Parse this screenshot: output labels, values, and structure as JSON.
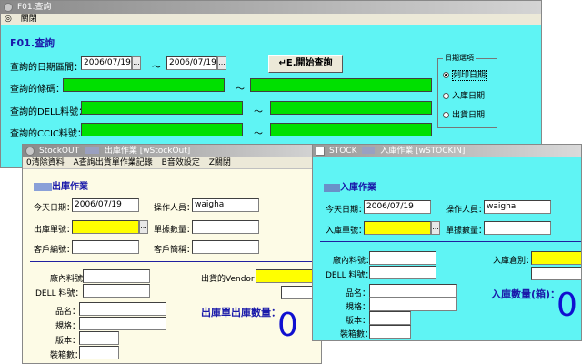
{
  "win1": {
    "title": "F01.查詢",
    "menu_close": "關閉",
    "heading": "F01.查詢",
    "date_range_label": "查詢的日期區間：",
    "date_from": "2006/07/19",
    "tilde": "～",
    "date_to": "2006/07/19",
    "start_button": "E.開始查詢",
    "barcode_label": "查詢的條碼：",
    "dell_label": "查詢的DELL料號：",
    "ccic_label": "查詢的CCIC料號：",
    "dash": "～",
    "date_group_title": "日期選項",
    "radio_print": "列印日期",
    "radio_in": "入庫日期",
    "radio_out": "出貨日期",
    "colors": {
      "window_bg": "#5ff4f4",
      "green_field": "#00e000"
    }
  },
  "win2": {
    "title_prefix": "StockOUT",
    "title_main": "出庫作業 [wStockOut]",
    "menu": [
      "0清除資料",
      "A查詢出貨單作業記錄",
      "B音效設定",
      "Z關閉"
    ],
    "heading": "出庫作業",
    "today_label": "今天日期：",
    "today_value": "2006/07/19",
    "operator_label": "操作人員：",
    "operator_value": "waigha",
    "order_label": "出庫單號：",
    "order_lines_label": "單據數量：",
    "customer_no_label": "客戶編號：",
    "customer_name_label": "客戶簡稱：",
    "part_label": "廠內料號：",
    "dell_label": "DELL 料號：",
    "vendor_label": "出貨的Vendor：",
    "name_label": "品名：",
    "spec_label": "規格：",
    "version_label": "版本：",
    "box_label": "裝箱數：",
    "qty_title": "出庫單出庫數量：",
    "qty_value": "0",
    "colors": {
      "window_bg": "#fdfbe6"
    }
  },
  "win3": {
    "title_prefix": "STOCK",
    "title_main": "入庫作業 [wSTOCKIN]",
    "heading": "入庫作業",
    "today_label": "今天日期：",
    "today_value": "2006/07/19",
    "operator_label": "操作人員：",
    "operator_value": "waigha",
    "order_label": "入庫單號：",
    "order_lines_label": "單據數量：",
    "part_label": "廠內料號：",
    "dell_label": "DELL 料號：",
    "warehouse_label": "入庫倉別：",
    "name_label": "品名：",
    "spec_label": "規格：",
    "version_label": "版本：",
    "box_label": "裝箱數：",
    "qty_title": "入庫數量(箱)：",
    "qty_value": "0",
    "colors": {
      "window_bg": "#5ff4f4"
    }
  }
}
